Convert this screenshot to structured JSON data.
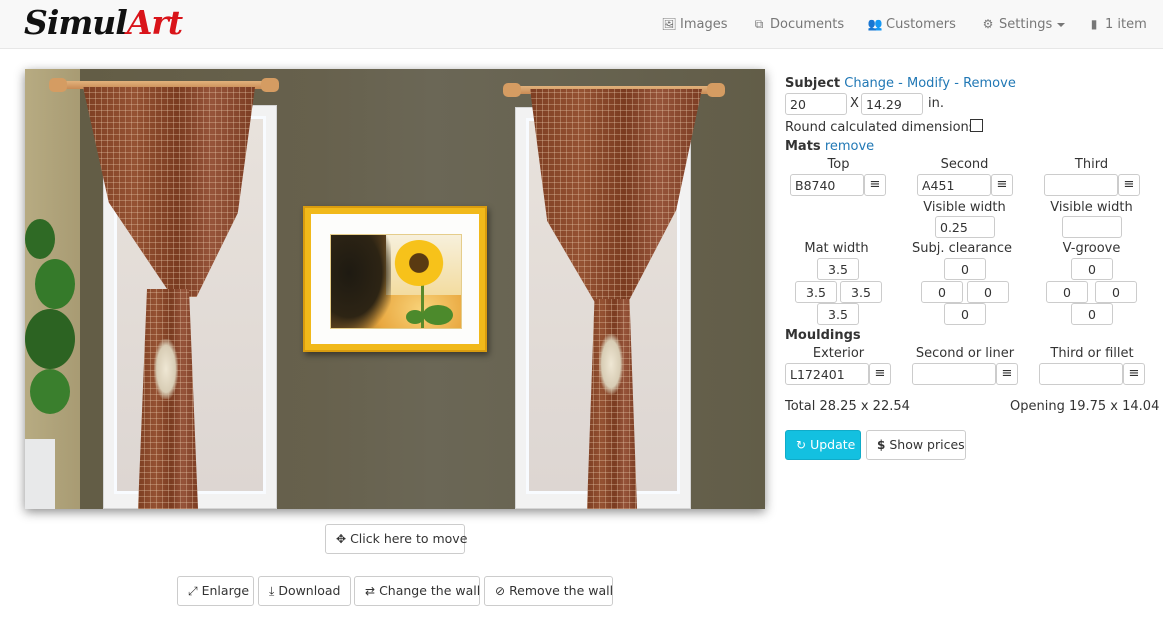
{
  "brand": {
    "part1": "Simul",
    "part2": "Art"
  },
  "nav": {
    "images": {
      "icon": "picture-icon",
      "glyph": "🖼",
      "label": "Images"
    },
    "documents": {
      "icon": "documents-icon",
      "glyph": "⧉",
      "label": "Documents"
    },
    "customers": {
      "icon": "users-icon",
      "glyph": "👥",
      "label": "Customers"
    },
    "settings": {
      "icon": "gear-icon",
      "glyph": "⚙",
      "label": "Settings"
    },
    "cart": {
      "icon": "file-icon",
      "glyph": "▮",
      "label": "1 item"
    }
  },
  "preview": {
    "move_button": {
      "icon": "move-icon",
      "glyph": "✥",
      "label": "Click here to move"
    },
    "actions": [
      {
        "icon": "resize-icon",
        "glyph": "⤢",
        "label": "Enlarge"
      },
      {
        "icon": "download-icon",
        "glyph": "⤓",
        "label": "Download"
      },
      {
        "icon": "swap-icon",
        "glyph": "⇄",
        "label": "Change the wall"
      },
      {
        "icon": "eye-slash-icon",
        "glyph": "⊘",
        "label": "Remove the wall"
      }
    ]
  },
  "subject": {
    "title": "Subject",
    "change": "Change",
    "sep": " - ",
    "modify": "Modify",
    "remove": "Remove",
    "width": "20",
    "x": "X",
    "height": "14.29",
    "unit": "in.",
    "round_label": "Round calculated dimensions",
    "round_checked": false
  },
  "mats": {
    "title": "Mats",
    "remove": "remove",
    "top_label": "Top",
    "second_label": "Second",
    "third_label": "Third",
    "top_value": "B8740",
    "second_value": "A451",
    "third_value": "",
    "visible_width_label": "Visible width",
    "second_visible_width": "0.25",
    "third_visible_width": "",
    "mat_width_label": "Mat width",
    "mat_width": {
      "top": "3.5",
      "left": "3.5",
      "right": "3.5",
      "bottom": "3.5"
    },
    "clearance_label": "Subj. clearance",
    "clearance": {
      "top": "0",
      "left": "0",
      "right": "0",
      "bottom": "0"
    },
    "vgroove_label": "V-groove",
    "vgroove": {
      "top": "0",
      "left": "0",
      "right": "0",
      "bottom": "0"
    },
    "list_glyph": "≡"
  },
  "mouldings": {
    "title": "Mouldings",
    "exterior_label": "Exterior",
    "second_label": "Second or liner",
    "third_label": "Third or fillet",
    "exterior_value": "L172401",
    "second_value": "",
    "third_value": ""
  },
  "summary": {
    "total": "Total 28.25 x 22.54",
    "opening": "Opening 19.75 x 14.04"
  },
  "actions": {
    "update": {
      "icon": "refresh-icon",
      "glyph": "↻",
      "label": "Update"
    },
    "prices": {
      "icon": "dollar-icon",
      "glyph": "$",
      "label": "Show prices"
    }
  },
  "colors": {
    "accent": "#13c0e0",
    "link": "#2178b5",
    "brand_red": "#d9141a",
    "frame_gold": "#f1b91a"
  }
}
